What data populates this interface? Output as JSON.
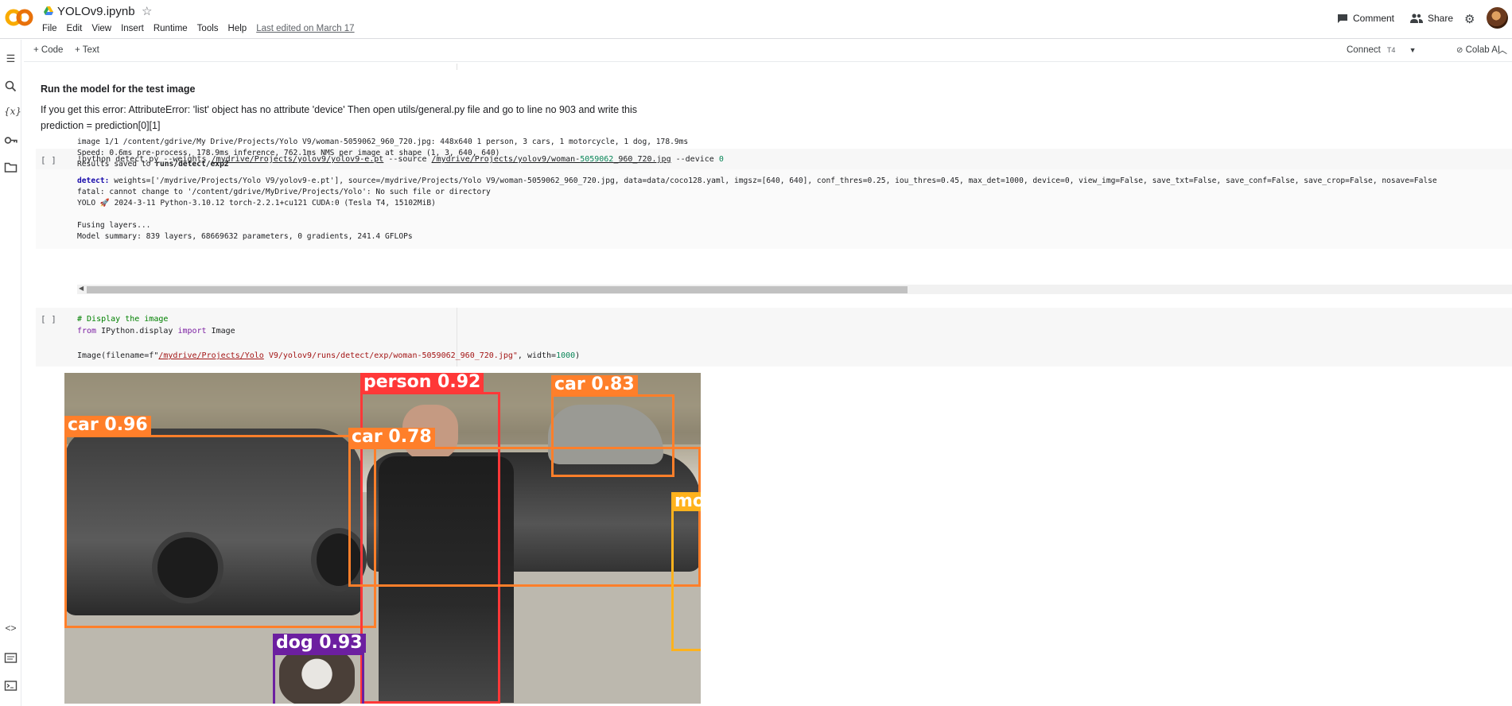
{
  "app": {
    "title": "YOLOv9.ipynb",
    "menu": [
      "File",
      "Edit",
      "View",
      "Insert",
      "Runtime",
      "Tools",
      "Help"
    ],
    "last_edited": "Last edited on March 17",
    "comment_label": "Comment",
    "share_label": "Share"
  },
  "toolbar": {
    "add_code": "+ Code",
    "add_text": "+ Text",
    "connect": "Connect",
    "runtime_type": "T4",
    "colab_ai": "Colab AI"
  },
  "text_cell": {
    "heading": "Run the model for the test image",
    "para1": "If you get this error: AttributeError: 'list' object has no attribute 'device' Then open utils/general.py file and go to line no 903 and write this",
    "para2": "prediction = prediction[0][1]"
  },
  "cell1": {
    "bracket": "[ ]",
    "code_prefix": "!python detect.py --weights ",
    "weights_path": "/mydrive/Projects/yolov9/yolov9-e.pt",
    "code_mid": " --source ",
    "source_path_a": "/mydrive/Projects/yolov9/woman-",
    "source_num": "5059062",
    "source_path_b": "_960_720.jpg",
    "code_device": " --device ",
    "device_val": "0",
    "output": {
      "detect_key": "detect:",
      "detect_val": " weights=['/mydrive/Projects/Yolo V9/yolov9-e.pt'], source=/mydrive/Projects/Yolo V9/woman-5059062_960_720.jpg, data=data/coco128.yaml, imgsz=[640, 640], conf_thres=0.25, iou_thres=0.45, max_det=1000, device=0, view_img=False, save_txt=False, save_conf=False, save_crop=False, nosave=False",
      "line2": "fatal: cannot change to '/content/gdrive/MyDrive/Projects/Yolo': No such file or directory",
      "line3": "YOLO 🚀 2024-3-11 Python-3.10.12 torch-2.2.1+cu121 CUDA:0 (Tesla T4, 15102MiB)",
      "line4": "Fusing layers...",
      "line5": "Model summary: 839 layers, 68669632 parameters, 0 gradients, 241.4 GFLOPs",
      "line6": "image 1/1 /content/gdrive/My Drive/Projects/Yolo V9/woman-5059062_960_720.jpg: 448x640 1 person, 3 cars, 1 motorcycle, 1 dog, 178.9ms",
      "line7": "Speed: 0.6ms pre-process, 178.9ms inference, 762.1ms NMS per image at shape (1, 3, 640, 640)",
      "line8_prefix": "Results saved to ",
      "line8_path": "runs/detect/exp2"
    }
  },
  "cell2": {
    "bracket": "[ ]",
    "comment": "# Display the image",
    "kw_from": "from",
    "module": " IPython.display ",
    "kw_import": "import",
    "name": " Image",
    "call_prefix": "Image(filename=f\"",
    "call_path": "/mydrive/Projects/Yolo",
    "call_rest": " V9/yolov9/runs/detect/exp/woman-5059062_960_720.jpg\"",
    "call_width": ", width=",
    "call_width_val": "1000",
    "call_end": ")"
  },
  "detections": [
    {
      "label": "car 0.96",
      "color": "#ff7f2a"
    },
    {
      "label": "person 0.92",
      "color": "#ff3838"
    },
    {
      "label": "car 0.83",
      "color": "#ff7f2a"
    },
    {
      "label": "car 0.78",
      "color": "#ff7f2a"
    },
    {
      "label": "mo",
      "color": "#ffb21d"
    },
    {
      "label": "dog 0.93",
      "color": "#6c1fa0"
    }
  ],
  "icons": {
    "rail": [
      "toc-icon",
      "search-icon",
      "variables-icon",
      "secrets-key-icon",
      "files-folder-icon",
      "code-snippets-icon",
      "command-palette-icon",
      "terminal-icon"
    ],
    "header": [
      "colab-logo-icon",
      "drive-icon",
      "star-icon",
      "comment-icon",
      "share-icon",
      "settings-gear-icon",
      "avatar"
    ]
  }
}
